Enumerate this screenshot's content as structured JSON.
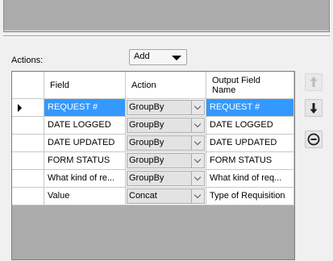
{
  "actions_label": "Actions:",
  "add_dropdown": {
    "value": "Add"
  },
  "grid": {
    "headers": {
      "field": "Field",
      "action": "Action",
      "output": "Output Field Name"
    },
    "rows": [
      {
        "field": "REQUEST #",
        "action": "GroupBy",
        "output": "REQUEST #",
        "selected": true
      },
      {
        "field": "DATE LOGGED",
        "action": "GroupBy",
        "output": "DATE LOGGED"
      },
      {
        "field": "DATE UPDATED",
        "action": "GroupBy",
        "output": "DATE UPDATED"
      },
      {
        "field": "FORM STATUS",
        "action": "GroupBy",
        "output": "FORM STATUS"
      },
      {
        "field": "What kind of re...",
        "action": "GroupBy",
        "output": "What kind of req..."
      },
      {
        "field": "Value",
        "action": "Concat",
        "output": "Type of Requisition"
      }
    ]
  },
  "side_buttons": [
    "move-up-icon",
    "move-down-icon",
    "remove-icon"
  ],
  "colors": {
    "selection": "#3399ff",
    "grid_bg": "#ababab"
  }
}
